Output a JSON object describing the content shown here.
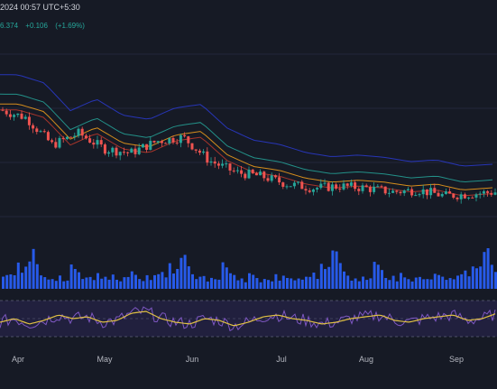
{
  "header": {
    "timestamp": "2024 00:57 UTC+5:30"
  },
  "ohlc_row": {
    "price": "6.374",
    "change": "+0.106",
    "change_pct": "(+1.69%)"
  },
  "colors": {
    "background": "#161a25",
    "up": "#26a69a",
    "down": "#ef5350",
    "ma_teal": "#26a69a",
    "ma_orange": "#f7a21b",
    "ma_red": "#c0392b",
    "ma_blue": "#2a3bd0",
    "volume": "#2962ff",
    "rsi_line": "#7e57c2",
    "rsi_ma": "#e0c043",
    "rsi_band": "#2a2550"
  },
  "chart_data": {
    "type": "candlestick",
    "title": "",
    "x_labels": [
      "Apr",
      "May",
      "Jun",
      "Jul",
      "Aug",
      "Sep"
    ],
    "price_trend": [
      8.5,
      8.3,
      7.6,
      7.9,
      7.5,
      7.4,
      7.7,
      7.8,
      7.2,
      6.9,
      6.8,
      6.6,
      6.5,
      6.55,
      6.5,
      6.4,
      6.45,
      6.3,
      6.35,
      6.4
    ],
    "volume_relative": [
      0.3,
      0.35,
      0.4,
      0.3,
      0.6,
      0.45,
      0.5,
      0.8,
      1.0,
      0.55,
      0.4,
      0.3,
      0.25,
      0.3,
      0.2,
      0.3,
      0.2,
      0.25,
      0.6,
      0.5,
      0.4,
      0.3,
      0.25,
      0.3,
      0.2,
      0.35,
      0.3,
      0.25,
      0.2,
      0.3,
      0.25,
      0.2,
      0.3,
      0.25,
      0.4,
      0.3,
      0.25,
      0.2,
      0.3,
      0.25
    ],
    "rsi_relative": [
      0.4,
      0.5,
      0.35,
      0.45,
      0.6,
      0.5,
      0.55,
      0.4,
      0.45,
      0.65,
      0.7,
      0.5,
      0.4,
      0.35,
      0.5,
      0.45,
      0.3,
      0.4,
      0.55,
      0.6,
      0.5,
      0.45,
      0.35,
      0.4,
      0.5,
      0.55,
      0.6,
      0.45,
      0.4,
      0.5,
      0.55,
      0.6,
      0.45,
      0.5,
      0.65
    ]
  }
}
